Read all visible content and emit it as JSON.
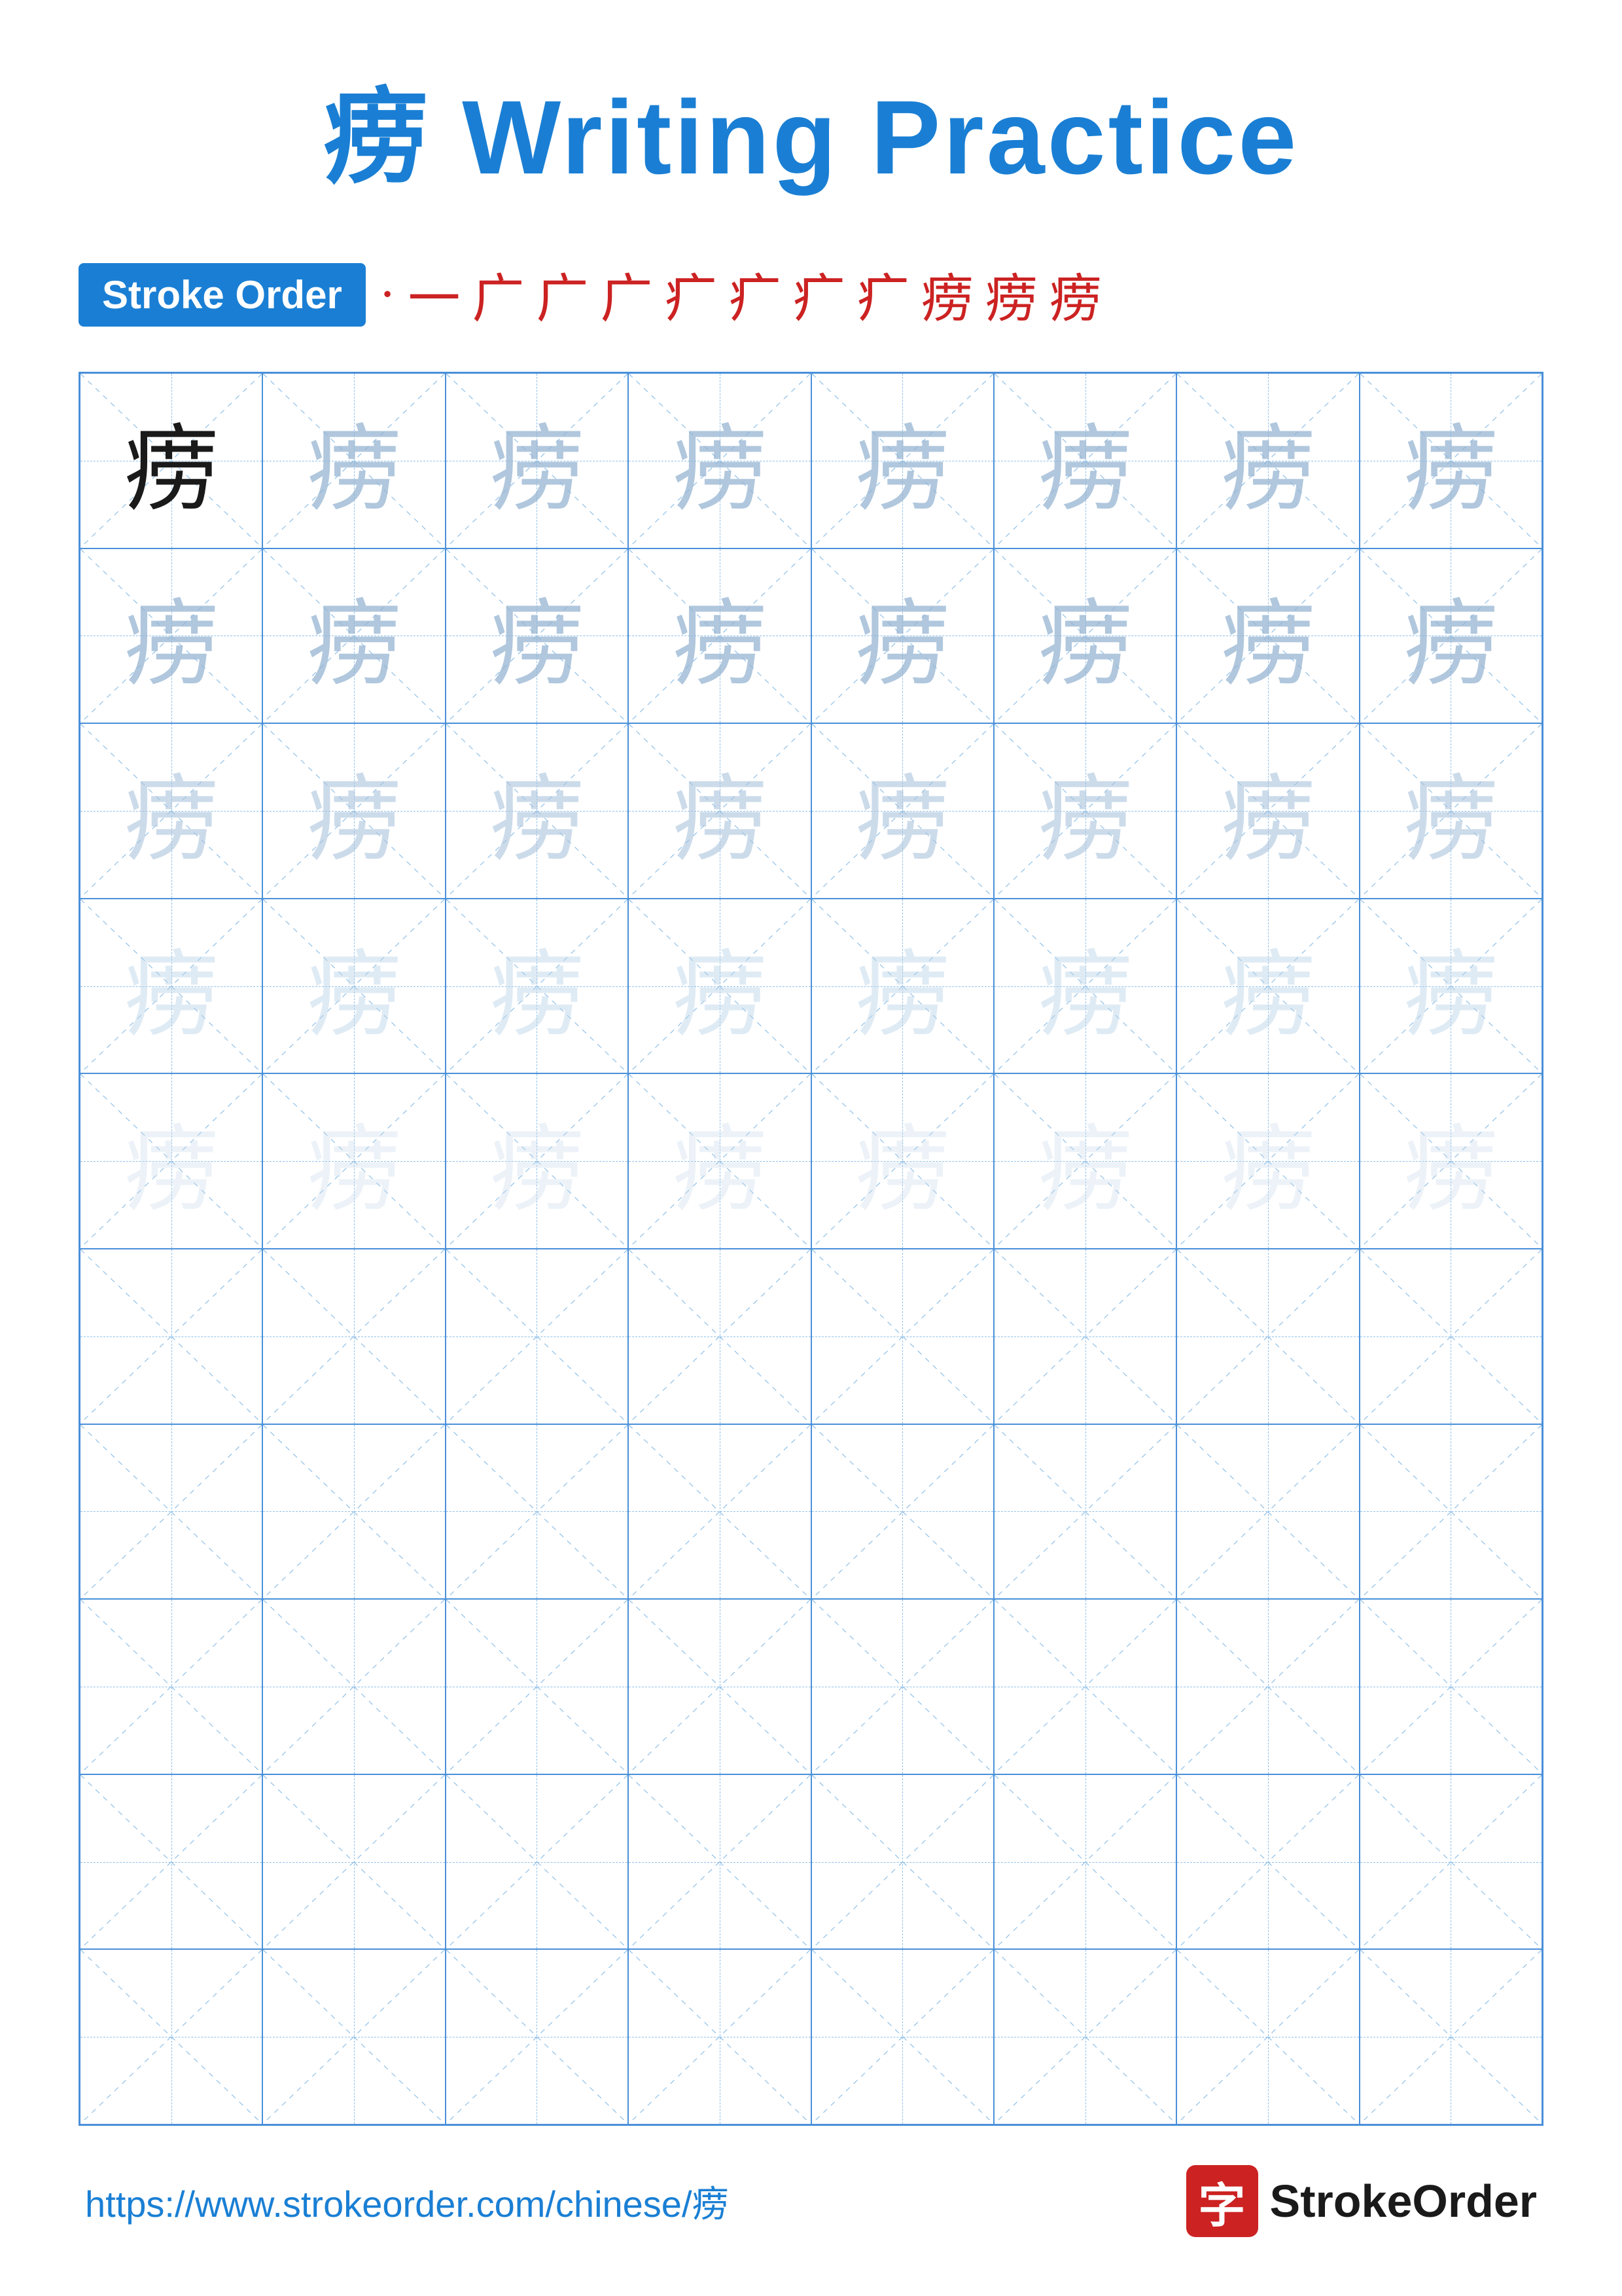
{
  "title": {
    "chinese": "痨",
    "english": " Writing Practice"
  },
  "stroke_order": {
    "badge_label": "Stroke Order",
    "strokes": [
      "·",
      "一",
      "广",
      "广",
      "广",
      "疒",
      "疒",
      "疒",
      "疒",
      "痨",
      "痨",
      "痨"
    ]
  },
  "grid": {
    "rows": 10,
    "cols": 8,
    "character": "痨",
    "filled_rows": 5
  },
  "footer": {
    "url": "https://www.strokeorder.com/chinese/痨",
    "logo_char": "字",
    "logo_text": "StrokeOrder"
  }
}
